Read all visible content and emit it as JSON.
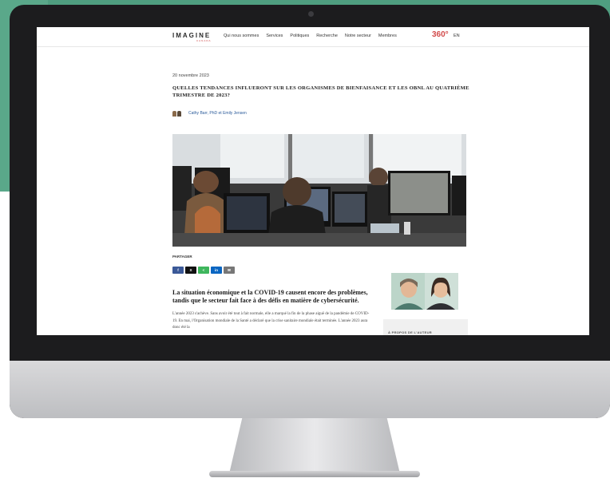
{
  "nav": {
    "logo": "IMAGINE",
    "logo_sub": "CANADA",
    "links": [
      "Qui nous sommes",
      "Services",
      "Politiques",
      "Recherche",
      "Notre secteur",
      "Membres"
    ],
    "badge_360": "360°",
    "lang": "EN"
  },
  "article": {
    "date": "20 novembre 2023",
    "title": "QUELLES TENDANCES INFLUERONT SUR LES ORGANISMES DE BIENFAISANCE ET LES OBNL AU QUATRIÈME TRIMESTRE DE 2023?",
    "authors": "Cathy Barr, PhD et Emily Jensen",
    "share_label": "PARTAGER",
    "share_buttons": [
      {
        "label": "f",
        "icon": "facebook-icon",
        "color": "#3b5998"
      },
      {
        "label": "X",
        "icon": "x-icon",
        "color": "#111111"
      },
      {
        "label": "<",
        "icon": "share-icon",
        "color": "#3fb65d"
      },
      {
        "label": "in",
        "icon": "linkedin-icon",
        "color": "#0a66c2"
      },
      {
        "label": "✉",
        "icon": "email-icon",
        "color": "#777777"
      }
    ],
    "lead": "La situation économique et la COVID-19 causent encore des problèmes, tandis que le secteur fait face à des défis en matière de cybersécurité.",
    "body": "L'année 2023 s'achève. Sans avoir été tout à fait normale, elle a marqué la fin de la phase aiguë de la pandémie de COVID-19. En mai, l'Organisation mondiale de la Santé a déclaré que la crise sanitaire mondiale était terminée. L'année 2023 aura donc été la"
  },
  "sidebar": {
    "about_label": "À PROPOS DE L'AUTEUR"
  },
  "colors": {
    "background_green": "#4f9e80",
    "accent_red": "#d24b4b",
    "link_blue": "#2a5a9a"
  }
}
